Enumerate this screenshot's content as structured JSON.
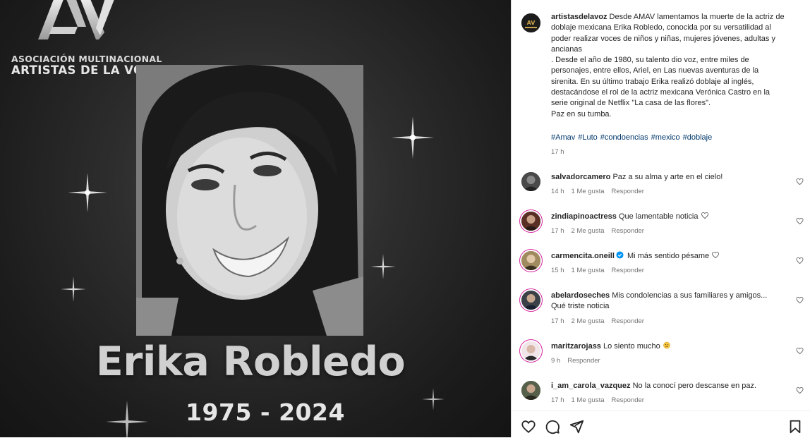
{
  "post": {
    "org_line1": "ASOCIACIÓN MULTINACIONAL",
    "org_line2": "ARTISTAS DE LA VOZ",
    "name": "Erika Robledo",
    "years": "1975 - 2024"
  },
  "caption": {
    "username": "artistasdelavoz",
    "text1": " Desde AMAV lamentamos la muerte de la actriz de doblaje mexicana Erika Robledo, conocida por su versatilidad al poder realizar voces de niños y niñas, mujeres jóvenes, adultas y ancianas",
    "text2": ". Desde el año de 1980, su talento dio voz, entre miles de personajes, entre ellos, Ariel, en Las nuevas aventuras de la sirenita. En su último trabajo Erika realizó doblaje al inglés, destacándose el rol de la actriz mexicana Verónica Castro en la serie original de Netflix \"La casa de las flores\".",
    "text3": "Paz en su tumba.",
    "hashtags": [
      "#Amav",
      "#Luto",
      "#condoencias",
      "#mexico",
      "#doblaje"
    ],
    "time": "17 h"
  },
  "comments": [
    {
      "user": "salvadorcamero",
      "text": "Paz a su alma y arte en el cielo!",
      "time": "14 h",
      "likes": "1 Me gusta",
      "reply": "Responder"
    },
    {
      "user": "zindiapinoactress",
      "text": "Que lamentable noticia",
      "time": "17 h",
      "likes": "2 Me gusta",
      "reply": "Responder"
    },
    {
      "user": "carmencita.oneill",
      "text": "Mi más sentido pésame",
      "time": "15 h",
      "likes": "1 Me gusta",
      "reply": "Responder"
    },
    {
      "user": "abelardoseches",
      "text": "Mis condolencias a sus familiares y amigos... Qué triste noticia",
      "time": "17 h",
      "likes": "2 Me gusta",
      "reply": "Responder"
    },
    {
      "user": "maritzarojass",
      "text": "Lo siento mucho",
      "time": "9 h",
      "likes": "",
      "reply": "Responder"
    },
    {
      "user": "i_am_carola_vazquez",
      "text": "No la conocí pero descanse en paz.",
      "time": "17 h",
      "likes": "1 Me gusta",
      "reply": "Responder"
    }
  ],
  "actions": {
    "icons": [
      "heart-icon",
      "comment-icon",
      "share-icon",
      "bookmark-icon"
    ]
  },
  "colors": {
    "hashtag": "#00376b",
    "meta": "#737373",
    "text": "#262626",
    "verified": "#0095f6"
  }
}
